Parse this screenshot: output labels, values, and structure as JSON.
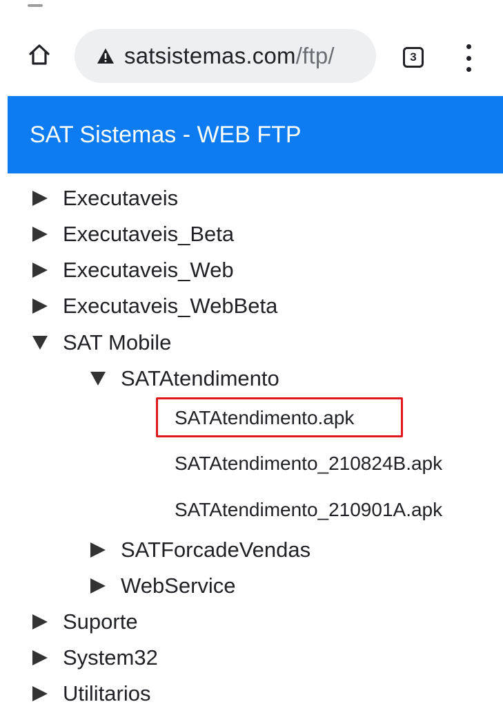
{
  "browser": {
    "url_host": "satsistemas.com",
    "url_path": "/ftp/",
    "tab_count": "3"
  },
  "header": {
    "title": "SAT Sistemas - WEB FTP",
    "background": "#0d7cf2"
  },
  "tree": {
    "executaveis": "Executaveis",
    "executaveis_beta": "Executaveis_Beta",
    "executaveis_web": "Executaveis_Web",
    "executaveis_webbeta": "Executaveis_WebBeta",
    "sat_mobile": {
      "label": "SAT Mobile",
      "expanded": true,
      "sat_atendimento": {
        "label": "SATAtendimento",
        "expanded": true,
        "files": [
          "SATAtendimento.apk",
          "SATAtendimento_210824B.apk",
          "SATAtendimento_210901A.apk"
        ]
      },
      "sat_forca_vendas": "SATForcadeVendas",
      "webservice": "WebService"
    },
    "suporte": "Suporte",
    "system32": "System32",
    "utilitarios": "Utilitarios"
  },
  "highlight_color": "#e0181c"
}
